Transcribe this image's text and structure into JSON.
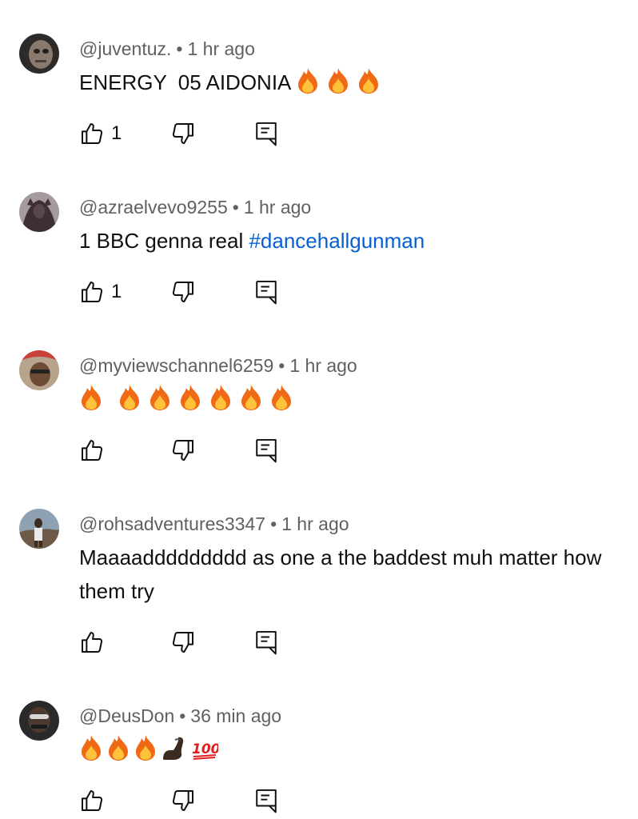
{
  "comments": [
    {
      "handle": "@juventuz.",
      "sep": "•",
      "time": "1 hr ago",
      "text": "ENERGY  05 AIDONIA ",
      "emojis": [
        "fire",
        "fire",
        "fire"
      ],
      "likes": "1",
      "avatar_colors": [
        "#3a3533",
        "#8d7d70"
      ]
    },
    {
      "handle": "@azraelvevo9255",
      "sep": "•",
      "time": "1 hr ago",
      "text": "1 BBC genna real ",
      "hashtag": "#dancehallgunman",
      "likes": "1",
      "avatar_colors": [
        "#9a8f95",
        "#3c2d33"
      ]
    },
    {
      "handle": "@myviewschannel6259",
      "sep": "•",
      "time": "1 hr ago",
      "text": "",
      "emojis": [
        "fire",
        "fire",
        "fire",
        "fire",
        "fire",
        "fire",
        "fire"
      ],
      "likes": "",
      "avatar_colors": [
        "#c9423a",
        "#6e4b35"
      ]
    },
    {
      "handle": "@rohsadventures3347",
      "sep": "•",
      "time": "1 hr ago",
      "text": "Maaaaddddddddd as one a the baddest muh matter how them try",
      "likes": "",
      "avatar_colors": [
        "#7a8ea3",
        "#5b4a3c"
      ]
    },
    {
      "handle": "@DeusDon",
      "sep": "•",
      "time": "36 min ago",
      "text": "",
      "emojis": [
        "fire",
        "fire",
        "fire",
        "flexed-biceps",
        "hundred-points"
      ],
      "likes": "",
      "avatar_colors": [
        "#3b3b3b",
        "#1f1f1f"
      ]
    }
  ]
}
